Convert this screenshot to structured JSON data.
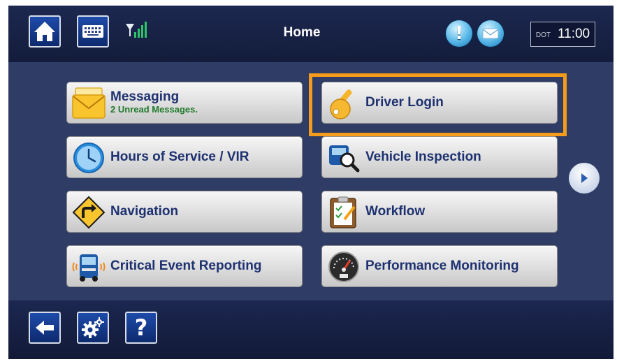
{
  "header": {
    "title": "Home",
    "dot_label": "DOT",
    "time": "11:00",
    "icons": [
      "home-icon",
      "keyboard-icon",
      "signal-icon",
      "alert-icon",
      "mail-icon"
    ]
  },
  "menu": {
    "messaging": {
      "label": "Messaging",
      "sublabel": "2 Unread Messages."
    },
    "driver_login": {
      "label": "Driver Login"
    },
    "hours_of_service": {
      "label": "Hours of Service / VIR"
    },
    "vehicle_inspection": {
      "label": "Vehicle Inspection"
    },
    "navigation": {
      "label": "Navigation"
    },
    "workflow": {
      "label": "Workflow"
    },
    "critical_event": {
      "label": "Critical Event Reporting"
    },
    "performance": {
      "label": "Performance Monitoring"
    }
  },
  "footer": {
    "help_label": "?",
    "icons": [
      "back-arrow-icon",
      "settings-gears-icon",
      "help-icon"
    ]
  },
  "colors": {
    "highlight": "#f59b1b",
    "button_text": "#1e3170",
    "sublabel_text": "#207a2a",
    "background": "#2f3c66"
  }
}
